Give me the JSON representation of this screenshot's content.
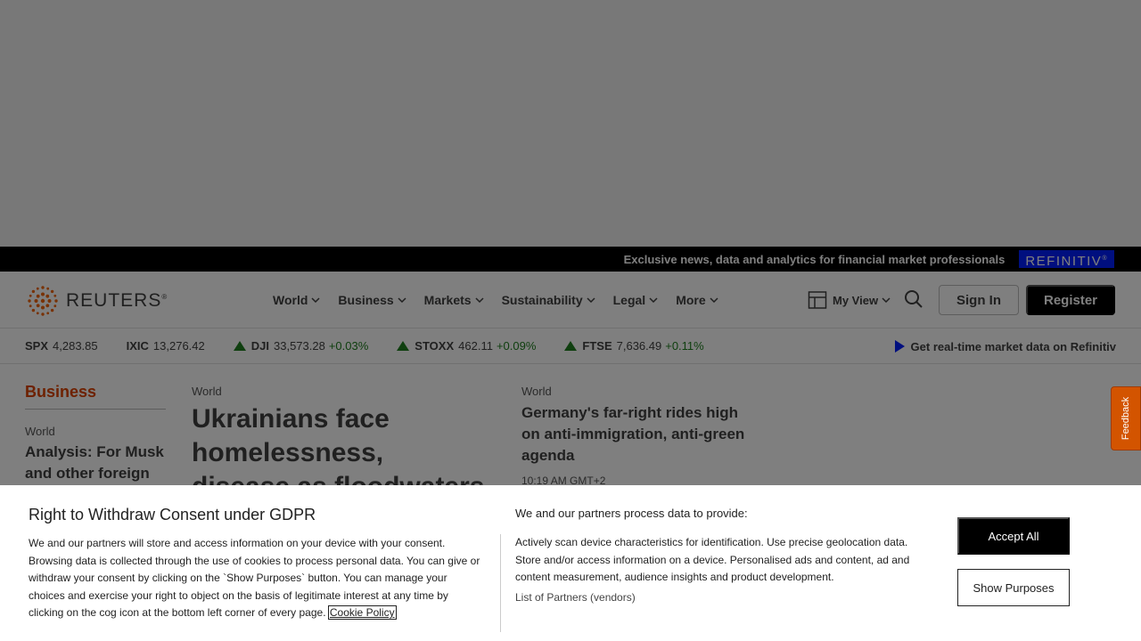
{
  "promo": {
    "text": "Exclusive news, data and analytics for financial market professionals",
    "brand": "REFINITIV",
    "brand_mark": "®"
  },
  "header": {
    "logo_text": "REUTERS",
    "logo_mark": "®",
    "nav": [
      {
        "label": "World"
      },
      {
        "label": "Business"
      },
      {
        "label": "Markets"
      },
      {
        "label": "Sustainability"
      },
      {
        "label": "Legal"
      },
      {
        "label": "More"
      }
    ],
    "my_view": "My View",
    "sign_in": "Sign In",
    "register": "Register"
  },
  "ticker": {
    "items": [
      {
        "symbol": "SPX",
        "value": "4,283.85",
        "change": "",
        "direction": "none"
      },
      {
        "symbol": "IXIC",
        "value": "13,276.42",
        "change": "",
        "direction": "none"
      },
      {
        "symbol": "DJI",
        "value": "33,573.28",
        "change": "+0.03%",
        "direction": "up"
      },
      {
        "symbol": "STOXX",
        "value": "462.11",
        "change": "+0.09%",
        "direction": "up"
      },
      {
        "symbol": "FTSE",
        "value": "7,636.49",
        "change": "+0.11%",
        "direction": "up"
      }
    ],
    "realtime_link": "Get real-time market data on Refinitiv"
  },
  "content": {
    "section_title": "Business",
    "left": {
      "kicker": "World",
      "headline": "Analysis: For Musk and other foreign"
    },
    "middle": {
      "kicker": "World",
      "headline": "Ukrainians face homelessness, disease as floodwaters crest"
    },
    "right": {
      "kicker": "World",
      "headline": "Germany's far-right rides high on anti-immigration, anti-green agenda",
      "time": "10:19 AM GMT+2"
    }
  },
  "feedback": "Feedback",
  "consent": {
    "title": "Right to Withdraw Consent under GDPR",
    "body": "We and our partners will store and access information on your device with your consent. Browsing data is collected through the use of cookies to process personal data. You can give or withdraw your consent by clicking on the `Show Purposes` button. You can manage your choices and exercise your right to object on the basis of legitimate interest at any time by clicking on the cog icon at the bottom left corner of every page.",
    "cookie_link": "Cookie Policy",
    "subtitle": "We and our partners process data to provide:",
    "purposes": "Actively scan device characteristics for identification. Use precise geolocation data. Store and/or access information on a device. Personalised ads and content, ad and content measurement, audience insights and product development.",
    "partners_link": "List of Partners (vendors)",
    "accept_all": "Accept All",
    "show_purposes": "Show Purposes"
  },
  "colors": {
    "accent": "#dc4300",
    "refinitiv_blue": "#001eff",
    "positive": "#1e7e1e"
  }
}
